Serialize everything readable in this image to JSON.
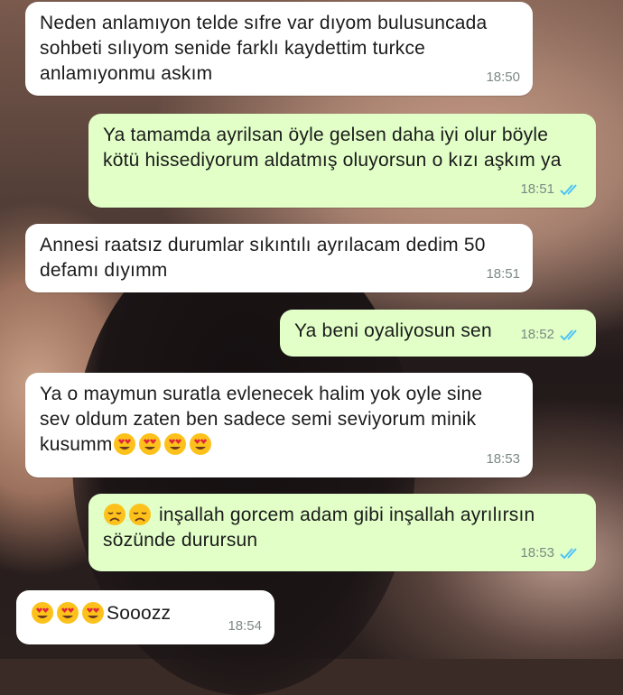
{
  "messages": [
    {
      "direction": "incoming",
      "text": "Neden anlamıyon telde sıfre var dıyom bulusuncada sohbeti sılıyom senide farklı kaydettim turkce anlamıyonmu askım",
      "time": "18:50"
    },
    {
      "direction": "outgoing",
      "text": "Ya tamamda ayrilsan öyle gelsen daha iyi olur böyle kötü hissediyorum aldatmış oluyorsun o kızı aşkım ya",
      "time": "18:51",
      "status": "read"
    },
    {
      "direction": "incoming",
      "text": "Annesi raatsız durumlar sıkıntılı ayrılacam dedim 50 defamı dıyımm",
      "time": "18:51"
    },
    {
      "direction": "outgoing",
      "text": "Ya beni oyaliyosun sen",
      "time": "18:52",
      "status": "read"
    },
    {
      "direction": "incoming",
      "text": "Ya o maymun suratla evlenecek halim yok oyle sine sev oldum zaten ben sadece semi seviyorum minik kusumm",
      "emojis_after": [
        "heart-eyes",
        "heart-eyes",
        "heart-eyes",
        "heart-eyes"
      ],
      "time": "18:53"
    },
    {
      "direction": "outgoing",
      "emojis_before": [
        "disappointed",
        "disappointed"
      ],
      "text": "inşallah gorcem adam gibi inşallah ayrılırsın sözünde durursun",
      "time": "18:53",
      "status": "read"
    },
    {
      "direction": "incoming",
      "emojis_before": [
        "heart-eyes",
        "heart-eyes",
        "heart-eyes"
      ],
      "text": "Sooozz",
      "time": "18:54"
    }
  ],
  "colors": {
    "incoming_bubble": "#ffffff",
    "outgoing_bubble": "#e1ffc7",
    "read_ticks": "#4fc3f7",
    "timestamp": "#7c8a83"
  }
}
